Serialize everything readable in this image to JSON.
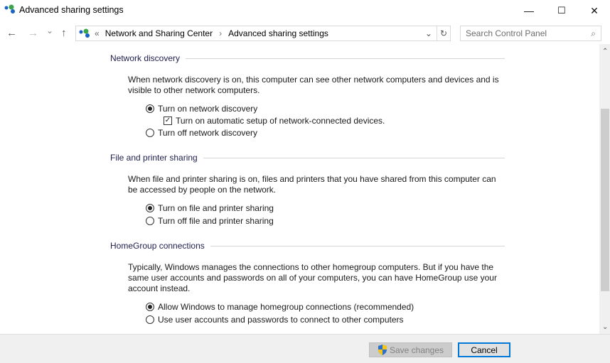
{
  "window": {
    "title": "Advanced sharing settings",
    "minimize": "—",
    "maximize": "☐",
    "close": "✕"
  },
  "nav": {
    "back": "←",
    "forward": "→",
    "recent": "⌄",
    "up": "↑"
  },
  "address": {
    "prefix": "«",
    "crumbs": [
      "Network and Sharing Center",
      "Advanced sharing settings"
    ],
    "sep": "›",
    "dropdown": "⌄",
    "refresh": "↻"
  },
  "search": {
    "placeholder": "Search Control Panel",
    "icon": "⌕"
  },
  "sections": [
    {
      "title": "Network discovery",
      "desc": "When network discovery is on, this computer can see other network computers and devices and is visible to other network computers.",
      "options": [
        "Turn on network discovery",
        "Turn off network discovery"
      ],
      "selected": 0,
      "checkbox": {
        "label": "Turn on automatic setup of network-connected devices.",
        "checked": true
      }
    },
    {
      "title": "File and printer sharing",
      "desc": "When file and printer sharing is on, files and printers that you have shared from this computer can be accessed by people on the network.",
      "options": [
        "Turn on file and printer sharing",
        "Turn off file and printer sharing"
      ],
      "selected": 0
    },
    {
      "title": "HomeGroup connections",
      "desc": "Typically, Windows manages the connections to other homegroup computers. But if you have the same user accounts and passwords on all of your computers, you can have HomeGroup use your account instead.",
      "options": [
        "Allow Windows to manage homegroup connections (recommended)",
        "Use user accounts and passwords to connect to other computers"
      ],
      "selected": 0
    }
  ],
  "footer": {
    "save": "Save changes",
    "cancel": "Cancel"
  },
  "colors": {
    "accent": "#0078d7"
  }
}
